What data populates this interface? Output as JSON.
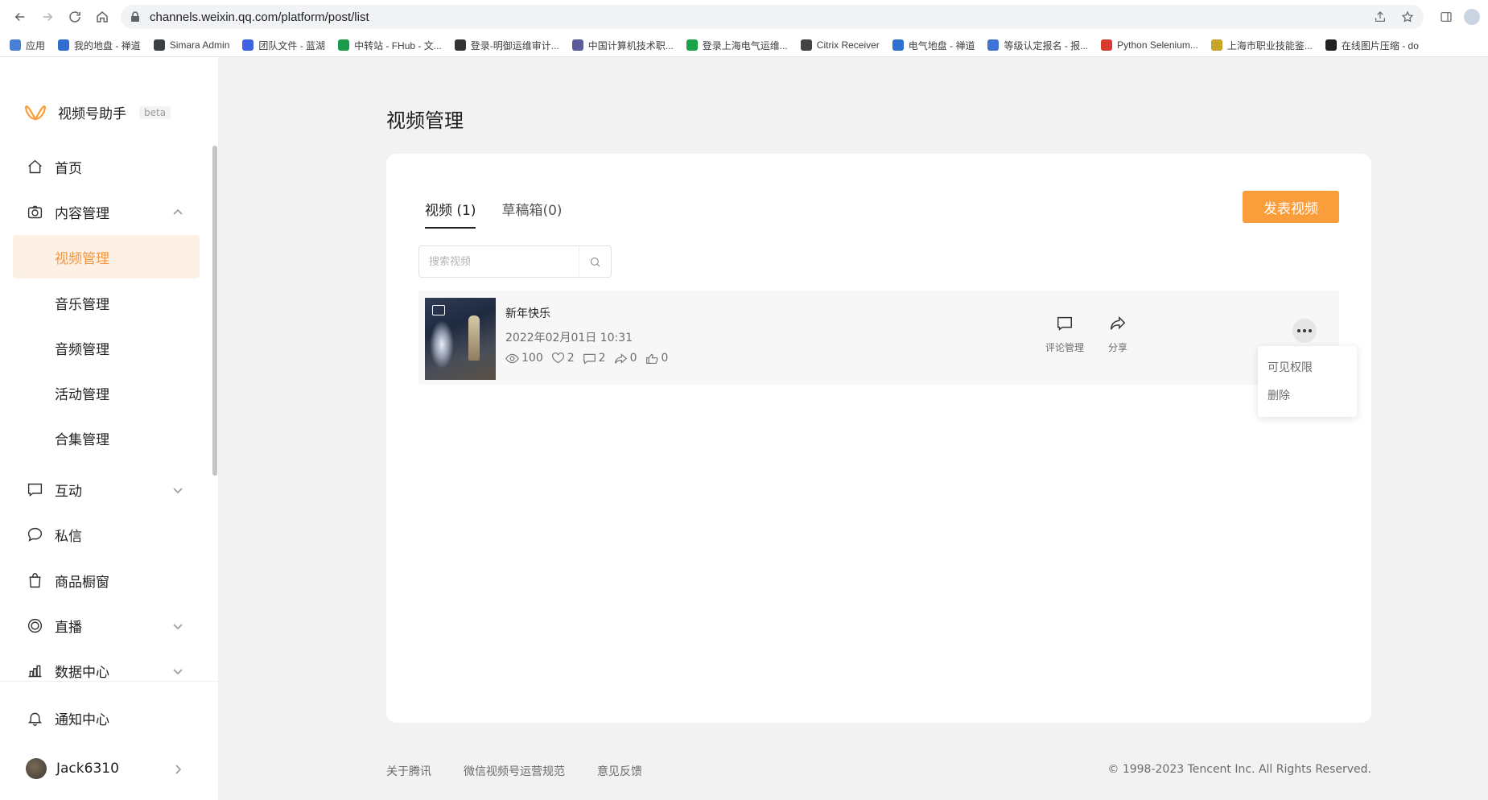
{
  "browser": {
    "url": "channels.weixin.qq.com/platform/post/list",
    "bookmarks": [
      {
        "label": "应用",
        "color": "#4a7fd8"
      },
      {
        "label": "我的地盘 - 禅道",
        "color": "#2f6fd1"
      },
      {
        "label": "Simara Admin",
        "color": "#3c4043"
      },
      {
        "label": "团队文件 - 蓝湖",
        "color": "#3f63e0"
      },
      {
        "label": "中转站 - FHub - 文...",
        "color": "#1e9b4a"
      },
      {
        "label": "登录-明御运维审计...",
        "color": "#333333"
      },
      {
        "label": "中国计算机技术职...",
        "color": "#5b5b9b"
      },
      {
        "label": "登录上海电气运维...",
        "color": "#1aa34a"
      },
      {
        "label": "Citrix Receiver",
        "color": "#444444"
      },
      {
        "label": "电气地盘 - 禅道",
        "color": "#2f6fd1"
      },
      {
        "label": "等级认定报名 - 报...",
        "color": "#3f74d6"
      },
      {
        "label": "Python Selenium...",
        "color": "#d83b2f"
      },
      {
        "label": "上海市职业技能鉴...",
        "color": "#c8a428"
      },
      {
        "label": "在线图片压缩 - do",
        "color": "#222222"
      }
    ]
  },
  "sidebar": {
    "app_name": "视频号助手",
    "badge": "beta",
    "items": [
      {
        "label": "首页",
        "icon": "home-icon"
      },
      {
        "label": "内容管理",
        "icon": "camera-icon"
      },
      {
        "label": "互动",
        "icon": "comment-icon"
      },
      {
        "label": "私信",
        "icon": "chat-bubble-icon"
      },
      {
        "label": "商品橱窗",
        "icon": "shopping-bag-icon"
      },
      {
        "label": "直播",
        "icon": "live-icon"
      },
      {
        "label": "数据中心",
        "icon": "bar-chart-icon"
      },
      {
        "label": "通知中心",
        "icon": "bell-icon"
      }
    ],
    "sub_items": [
      "视频管理",
      "音乐管理",
      "音频管理",
      "活动管理",
      "合集管理"
    ],
    "user": "Jack6310"
  },
  "main": {
    "page_title": "视频管理",
    "tabs": [
      "视频 (1)",
      "草稿箱(0)"
    ],
    "publish_label": "发表视频",
    "search_placeholder": "搜索视频",
    "post": {
      "title": "新年快乐",
      "date": "2022年02月01日 10:31",
      "views": "100",
      "likes": "2",
      "comments": "2",
      "shares": "0",
      "thumbs": "0"
    },
    "actions": {
      "comment_manage": "评论管理",
      "share": "分享"
    },
    "menu": [
      "可见权限",
      "删除"
    ]
  },
  "footer": {
    "links": [
      "关于腾讯",
      "微信视频号运营规范",
      "意见反馈"
    ],
    "copyright": "© 1998-2023 Tencent Inc. All Rights Reserved."
  },
  "colors": {
    "accent": "#fa9d3b",
    "active_bg": "#fdf1e6",
    "active_text": "#f3963f"
  }
}
